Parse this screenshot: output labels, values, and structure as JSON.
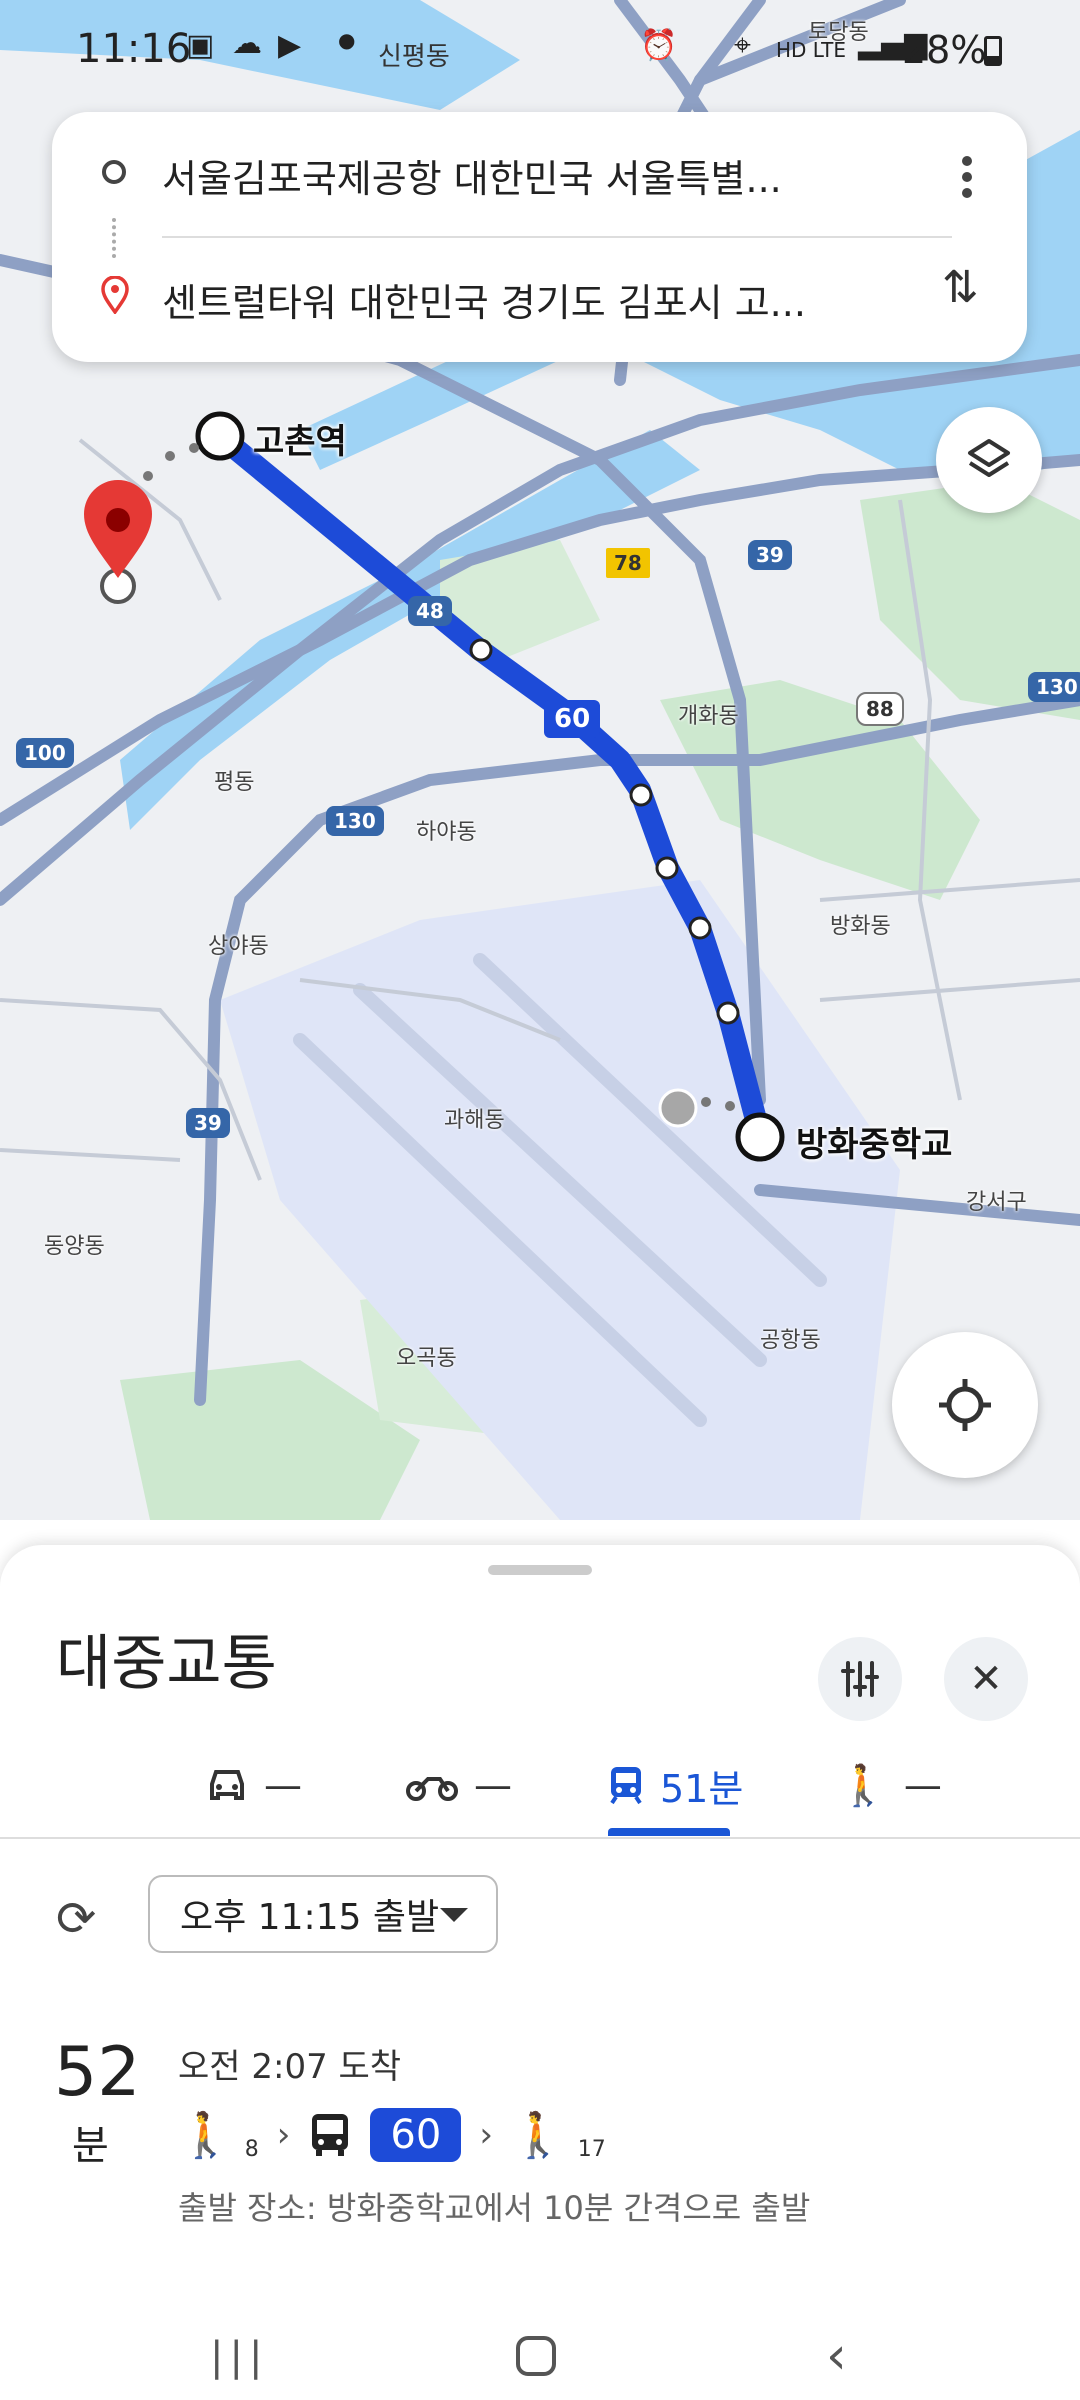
{
  "status_bar": {
    "time": "11:16",
    "location": "신평동",
    "battery": "28%",
    "network": "HD LTE"
  },
  "search": {
    "origin": "서울김포국제공항 대한민국 서울특별...",
    "destination": "센트럴타워 대한민국 경기도 김포시 고...",
    "more_icon": "more-vert-icon",
    "swap_icon": "swap-vert-icon"
  },
  "map": {
    "start_stop": "고촌역",
    "end_stop": "방화중학교",
    "route_numbers": [
      "48",
      "60"
    ],
    "highway_shields": [
      "78",
      "39",
      "88",
      "130",
      "100",
      "130",
      "39",
      "130"
    ],
    "place_labels": [
      "개화동",
      "평동",
      "하야동",
      "상야동",
      "방화동",
      "과해동",
      "강서구",
      "동양동",
      "오곡동",
      "공항동",
      "토당동"
    ],
    "route_color": "#1d4bd8",
    "pin_color": "#e53935"
  },
  "sheet": {
    "title": "대중교통",
    "tabs": [
      {
        "icon": "car-icon",
        "label": "—"
      },
      {
        "icon": "motorcycle-icon",
        "label": "—"
      },
      {
        "icon": "transit-icon",
        "label": "51분"
      },
      {
        "icon": "walk-icon",
        "label": "—"
      }
    ],
    "depart_time": "오후 11:15 출발",
    "result": {
      "duration": "52",
      "duration_unit": "분",
      "arrival": "오전 2:07 도착",
      "walk_start": "8",
      "bus": "60",
      "walk_end": "17",
      "note": "출발 장소: 방화중학교에서 10분 간격으로 출발"
    }
  }
}
